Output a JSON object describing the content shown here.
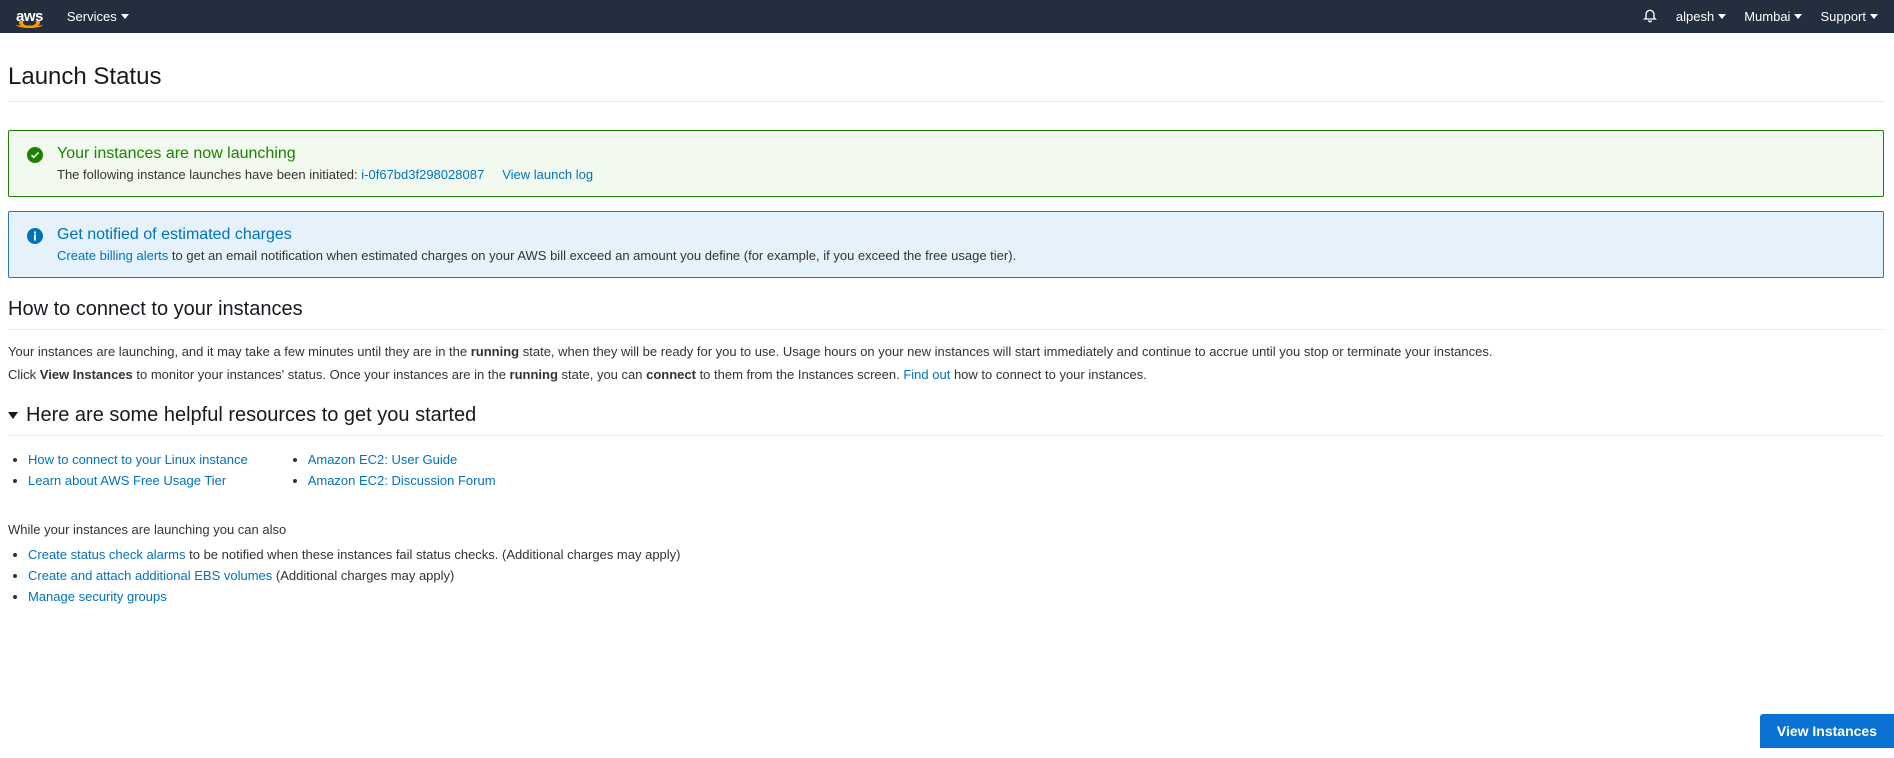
{
  "navbar": {
    "logo_text": "aws",
    "services_label": "Services",
    "user": "alpesh",
    "region": "Mumbai",
    "support": "Support"
  },
  "page": {
    "title": "Launch Status"
  },
  "alerts": {
    "success": {
      "title": "Your instances are now launching",
      "desc_prefix": "The following instance launches have been initiated:",
      "instance_id": "i-0f67bd3f298028087",
      "view_log": "View launch log"
    },
    "info": {
      "title": "Get notified of estimated charges",
      "link": "Create billing alerts",
      "rest": "to get an email notification when estimated charges on your AWS bill exceed an amount you define (for example, if you exceed the free usage tier)."
    }
  },
  "connect": {
    "heading": "How to connect to your instances",
    "p1_a": "Your instances are launching, and it may take a few minutes until they are in the ",
    "p1_b": "running",
    "p1_c": " state, when they will be ready for you to use. Usage hours on your new instances will start immediately and continue to accrue until you stop or terminate your instances.",
    "p2_a": "Click ",
    "p2_b": "View Instances",
    "p2_c": " to monitor your instances' status. Once your instances are in the ",
    "p2_d": "running",
    "p2_e": " state, you can ",
    "p2_f": "connect",
    "p2_g": " to them from the Instances screen. ",
    "p2_link": "Find out",
    "p2_h": " how to connect to your instances."
  },
  "resources": {
    "heading": "Here are some helpful resources to get you started",
    "col1": [
      "How to connect to your Linux instance",
      "Learn about AWS Free Usage Tier"
    ],
    "col2": [
      "Amazon EC2: User Guide",
      "Amazon EC2: Discussion Forum"
    ]
  },
  "also": {
    "intro": "While your instances are launching you can also",
    "items": [
      {
        "link": "Create status check alarms",
        "rest": " to be notified when these instances fail status checks. (Additional charges may apply)"
      },
      {
        "link": "Create and attach additional EBS volumes",
        "rest": " (Additional charges may apply)"
      },
      {
        "link": "Manage security groups",
        "rest": ""
      }
    ]
  },
  "buttons": {
    "view_instances": "View Instances"
  }
}
